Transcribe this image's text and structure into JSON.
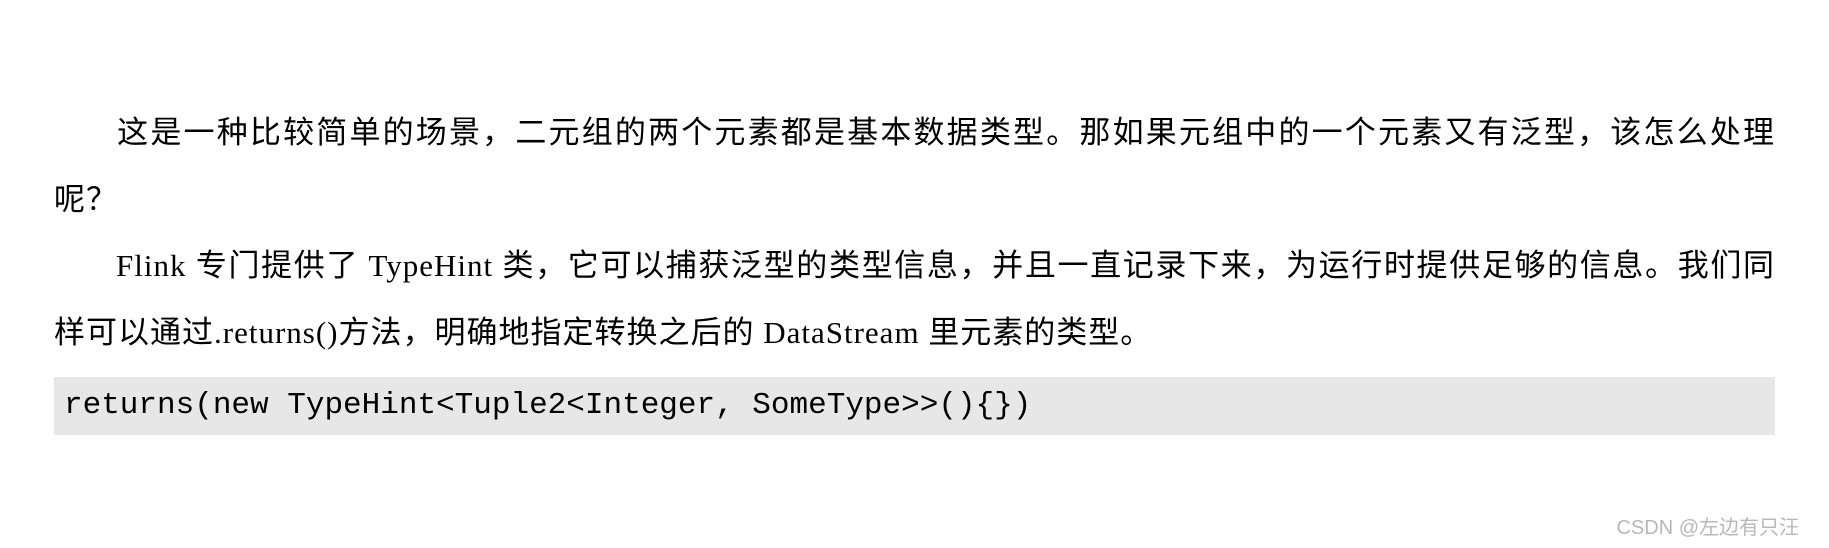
{
  "paragraphs": {
    "p1": "这是一种比较简单的场景，二元组的两个元素都是基本数据类型。那如果元组中的一个元素又有泛型，该怎么处理呢？",
    "p2_part1": "Flink 专门提供了 TypeHint 类，它可以捕获泛型的类型信息，并且一直记录下来，为运行时提供足够的信息。我们同样可以通过.returns()方法，明确地指定转换之后的 DataStream 里元素的类型。"
  },
  "code": "returns(new TypeHint<Tuple2<Integer, SomeType>>(){})",
  "watermark": "CSDN @左边有只汪"
}
